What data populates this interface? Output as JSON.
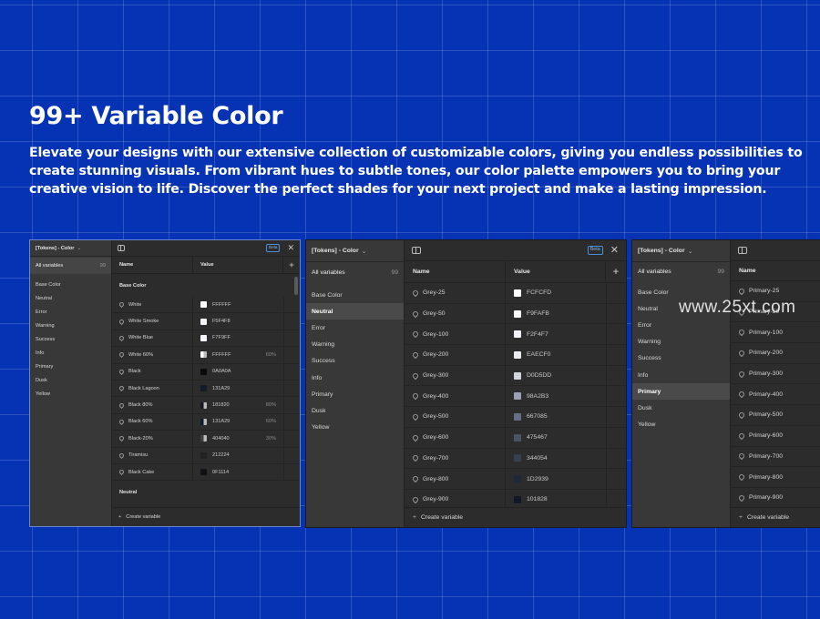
{
  "hero": {
    "title": "99+ Variable Color",
    "description": "Elevate your designs with our extensive collection of customizable colors, giving you endless possibilities to create stunning visuals. From vibrant hues to subtle tones, our color palette empowers you to bring your creative vision to life. Discover the perfect shades for your next project and make a lasting impression."
  },
  "watermark": "www.25xt.com",
  "colors": {
    "background": "#0533b3",
    "panel": "#2c2c2c",
    "sidebar": "#383838",
    "beta": "#7fb5f2"
  },
  "panel_common": {
    "collection": "[Tokens] - Color",
    "all_variables": "All variables",
    "count": "99",
    "beta": "Beta",
    "close": "✕",
    "col_name": "Name",
    "col_value": "Value",
    "add": "+",
    "create": "Create variable",
    "chevron": "⌄"
  },
  "panel1": {
    "groups": [
      "Base Color",
      "Neutral",
      "Error",
      "Warning",
      "Success",
      "Info",
      "Primary",
      "Dusk",
      "Yellow"
    ],
    "section": "Base Color",
    "section2": "Neutral",
    "rows": [
      {
        "name": "White",
        "value": "FFFFFF",
        "opacity": "",
        "color": "#FFFFFF"
      },
      {
        "name": "White Smoke",
        "value": "F5F4F8",
        "opacity": "",
        "color": "#F5F4F8"
      },
      {
        "name": "White Blue",
        "value": "F7F9FF",
        "opacity": "",
        "color": "#F7F9FF"
      },
      {
        "name": "White 60%",
        "value": "FFFFFF",
        "opacity": "60%",
        "color": "#FFFFFF"
      },
      {
        "name": "Black",
        "value": "0A0A0A",
        "opacity": "",
        "color": "#0A0A0A"
      },
      {
        "name": "Black Lagoon",
        "value": "131A29",
        "opacity": "",
        "color": "#131A29"
      },
      {
        "name": "Black 80%",
        "value": "181820",
        "opacity": "80%",
        "color": "#181820"
      },
      {
        "name": "Black 60%",
        "value": "131A29",
        "opacity": "60%",
        "color": "#131A29"
      },
      {
        "name": "Black-20%",
        "value": "404040",
        "opacity": "30%",
        "color": "#404040"
      },
      {
        "name": "Tiramisu",
        "value": "212224",
        "opacity": "",
        "color": "#212224"
      },
      {
        "name": "Black Cake",
        "value": "0F1114",
        "opacity": "",
        "color": "#0F1114"
      }
    ]
  },
  "panel2": {
    "groups": [
      "Base Color",
      "Neutral",
      "Error",
      "Warning",
      "Success",
      "Info",
      "Primary",
      "Dusk",
      "Yellow"
    ],
    "selected_group": "Neutral",
    "rows": [
      {
        "name": "Grey-25",
        "value": "FCFCFD",
        "color": "#FCFCFD"
      },
      {
        "name": "Grey-50",
        "value": "F9FAFB",
        "color": "#F9FAFB"
      },
      {
        "name": "Grey-100",
        "value": "F2F4F7",
        "color": "#F2F4F7"
      },
      {
        "name": "Grey-200",
        "value": "EAECF0",
        "color": "#EAECF0"
      },
      {
        "name": "Grey-300",
        "value": "D0D5DD",
        "color": "#D0D5DD"
      },
      {
        "name": "Grey-400",
        "value": "98A2B3",
        "color": "#98A2B3"
      },
      {
        "name": "Grey-500",
        "value": "667085",
        "color": "#667085"
      },
      {
        "name": "Grey-600",
        "value": "475467",
        "color": "#475467"
      },
      {
        "name": "Grey-700",
        "value": "344054",
        "color": "#344054"
      },
      {
        "name": "Grey-800",
        "value": "1D2939",
        "color": "#1D2939"
      },
      {
        "name": "Grey-900",
        "value": "101828",
        "color": "#101828"
      }
    ]
  },
  "panel3": {
    "groups": [
      "Base Color",
      "Neutral",
      "Error",
      "Warning",
      "Success",
      "Info",
      "Primary",
      "Dusk",
      "Yellow"
    ],
    "selected_group": "Primary",
    "rows": [
      "Primary-25",
      "Primary-50",
      "Primary-100",
      "Primary-200",
      "Primary-300",
      "Primary-400",
      "Primary-500",
      "Primary-600",
      "Primary-700",
      "Primary-800",
      "Primary-900"
    ]
  }
}
